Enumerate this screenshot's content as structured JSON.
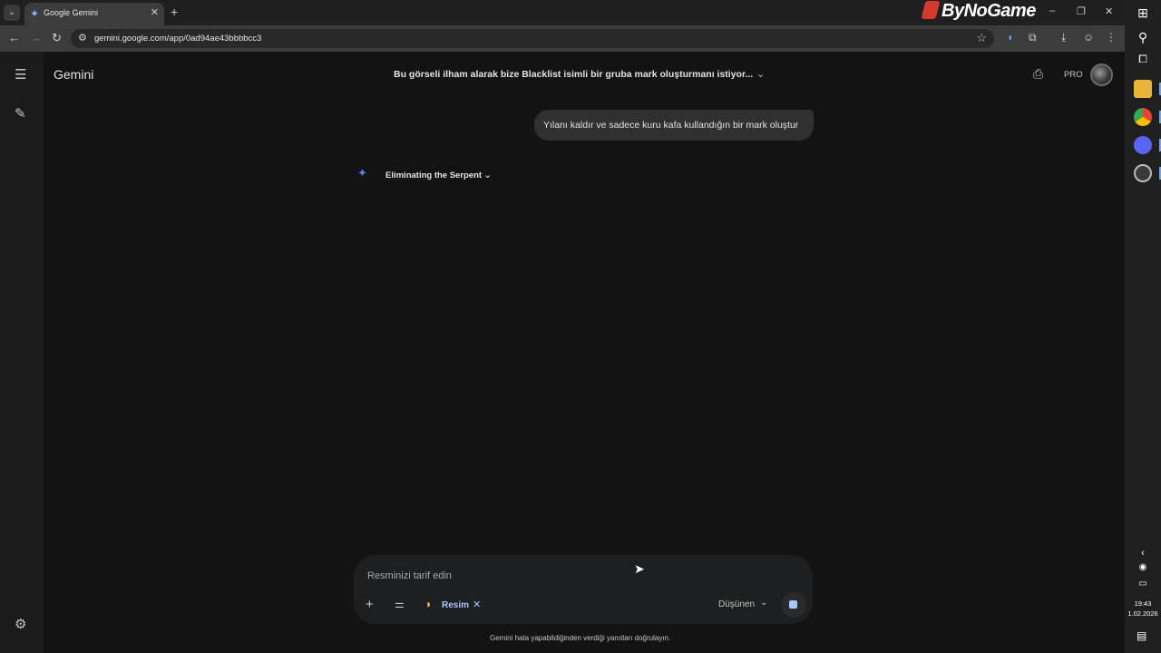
{
  "browser": {
    "tab": {
      "title": "Google Gemini",
      "icon": "gemini-spark-icon",
      "close": "✕"
    },
    "new_tab": "+",
    "brand": "ByNoGame",
    "window_controls": {
      "minimize": "–",
      "restore": "❐",
      "close": "✕"
    },
    "address": {
      "url": "gemini.google.com/app/0ad94ae43bbbbcc3"
    },
    "toolbar_icons": [
      "mic-icon",
      "extensions-icon",
      "download-icon",
      "profile-icon",
      "menu-icon"
    ]
  },
  "app": {
    "title": "Gemini",
    "conversation_title": "Bu görseli ilham alarak bize Blacklist isimli bir gruba mark oluşturmanı istiyor...",
    "pro_label": "PRO"
  },
  "messages": {
    "user": "Yılanı kaldır ve sadece kuru kafa kullandığın bir mark oluştur",
    "thinking_label": "Eliminating the Serpent"
  },
  "composer": {
    "placeholder": "Resminizi tarif edin",
    "chip_label": "Resim",
    "mode_label": "Düşünen"
  },
  "disclaimer": "Gemini hata yapabildiğinden verdiği yanıtları doğrulayın.",
  "taskbar": {
    "time": "19:43",
    "date": "1.02.2026"
  },
  "colors": {
    "background": "#131314",
    "accent": "#a8c7fa",
    "spark": "#4d86f7",
    "brand_red": "#d23a2e"
  }
}
